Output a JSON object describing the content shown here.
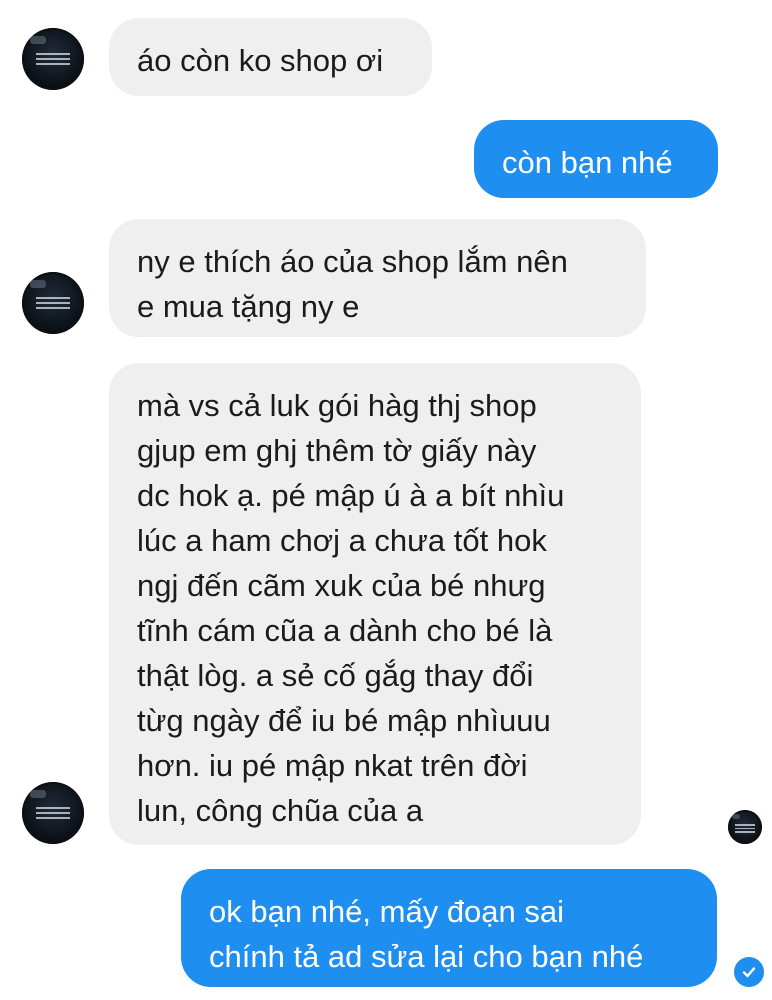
{
  "messages": [
    {
      "from": "customer",
      "text": "áo còn ko shop ơi"
    },
    {
      "from": "shop",
      "text": "còn bạn nhé"
    },
    {
      "from": "customer",
      "text": "ny e thích áo của shop lắm nên\ne mua tặng ny e"
    },
    {
      "from": "customer",
      "text": "mà vs cả luk gói hàg thj shop\ngjup em ghj thêm tờ giấy này\ndc hok ạ. pé mập ú à a bít nhìu\nlúc a ham chơj a chưa tốt hok\nngj đến cãm xuk của bé nhưg\ntĩnh cám cũa a dành cho bé là\nthật lòg. a sẻ cố gắg thay đổi\ntừg ngày để iu bé mập nhìuuu\nhơn. iu pé mập nkat trên đời\nlun, công chũa của a"
    },
    {
      "from": "shop",
      "text": "ok bạn nhé, mấy đoạn sai\nchính tả ad sửa lại cho bạn nhé"
    }
  ],
  "icons": {
    "avatar": "customer-avatar",
    "read_receipt": "seen-avatar",
    "sent": "check-circle-icon"
  },
  "colors": {
    "incoming_bubble": "#efefef",
    "outgoing_bubble": "#1e8ef1",
    "incoming_text": "#1b1b1b",
    "outgoing_text": "#ffffff"
  }
}
